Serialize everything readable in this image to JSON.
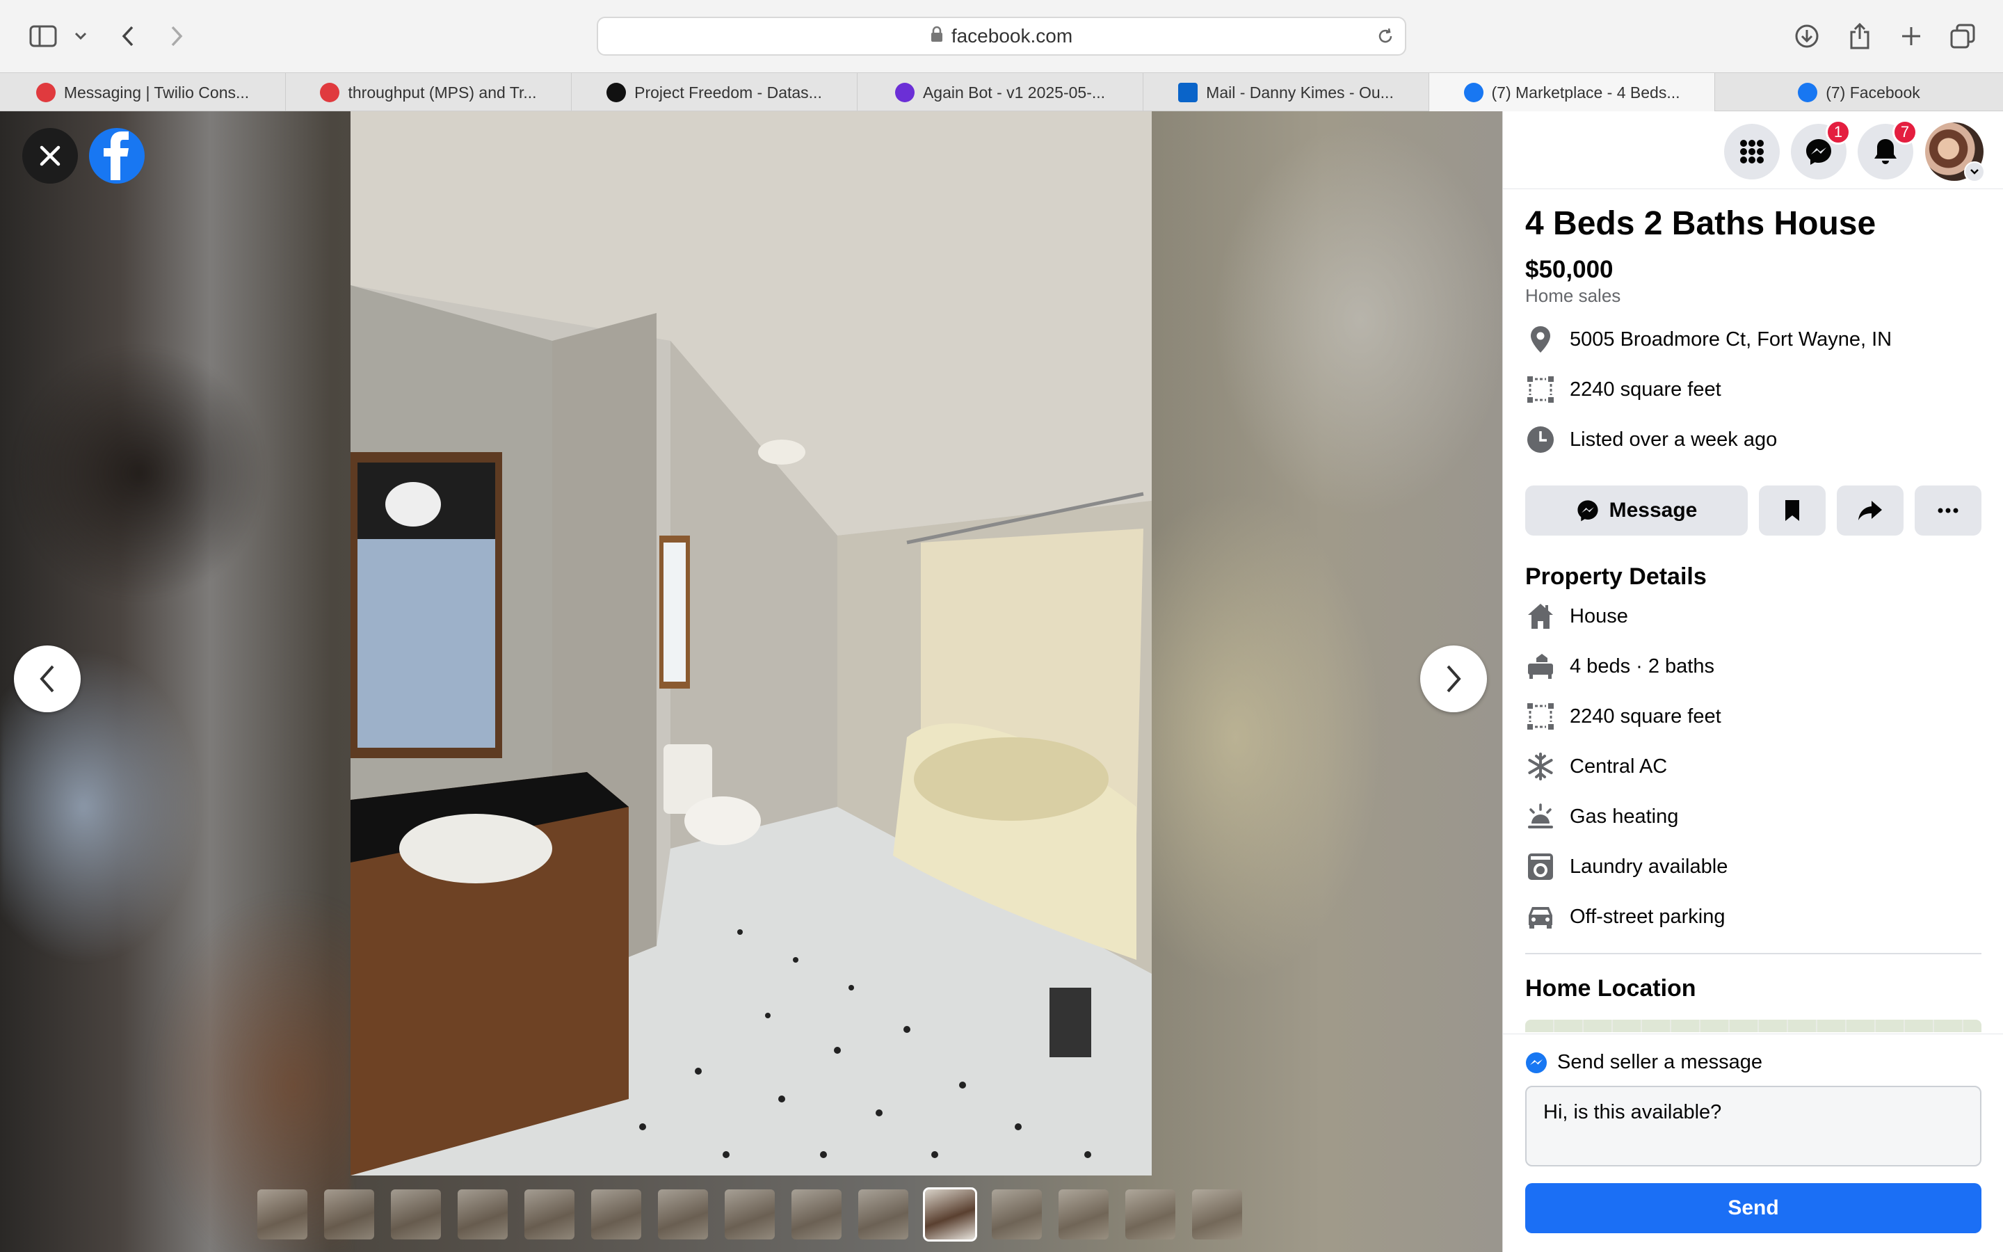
{
  "browser": {
    "url": "facebook.com",
    "tabs": [
      {
        "label": "Messaging | Twilio Cons...",
        "favicon_color": "#e03a3e"
      },
      {
        "label": "throughput (MPS) and Tr...",
        "favicon_color": "#e03a3e"
      },
      {
        "label": "Project Freedom - Datas...",
        "favicon_color": "#111111"
      },
      {
        "label": "Again Bot - v1 2025-05-...",
        "favicon_color": "#6b2fd6"
      },
      {
        "label": "Mail - Danny Kimes - Ou...",
        "favicon_color": "#0a64c9"
      },
      {
        "label": "(7) Marketplace - 4 Beds...",
        "favicon_color": "#1877f2"
      },
      {
        "label": "(7) Facebook",
        "favicon_color": "#1877f2"
      }
    ]
  },
  "header": {
    "messenger_badge": "1",
    "notifications_badge": "7"
  },
  "listing": {
    "title": "4 Beds 2 Baths House",
    "price": "$50,000",
    "category": "Home sales",
    "address": "5005 Broadmore Ct, Fort Wayne, IN",
    "area": "2240 square feet",
    "listed": "Listed over a week ago"
  },
  "actions": {
    "message_label": "Message"
  },
  "property_details": {
    "heading": "Property Details",
    "items": [
      {
        "label": "House",
        "icon": "house-icon"
      },
      {
        "label": "4 beds · 2 baths",
        "icon": "bed-icon"
      },
      {
        "label": "2240 square feet",
        "icon": "area-icon"
      },
      {
        "label": "Central AC",
        "icon": "snowflake-icon"
      },
      {
        "label": "Gas heating",
        "icon": "heat-icon"
      },
      {
        "label": "Laundry available",
        "icon": "washer-icon"
      },
      {
        "label": "Off-street parking",
        "icon": "car-icon"
      }
    ]
  },
  "home_location": {
    "heading": "Home Location"
  },
  "messaging": {
    "heading": "Send seller a message",
    "input_value": "Hi, is this available?",
    "send_label": "Send"
  },
  "gallery": {
    "thumbnail_count": 15,
    "selected_index": 10
  },
  "colors": {
    "facebook_blue": "#1877f2",
    "send_button": "#1b6ff5",
    "badge_red": "#e41e3f"
  }
}
